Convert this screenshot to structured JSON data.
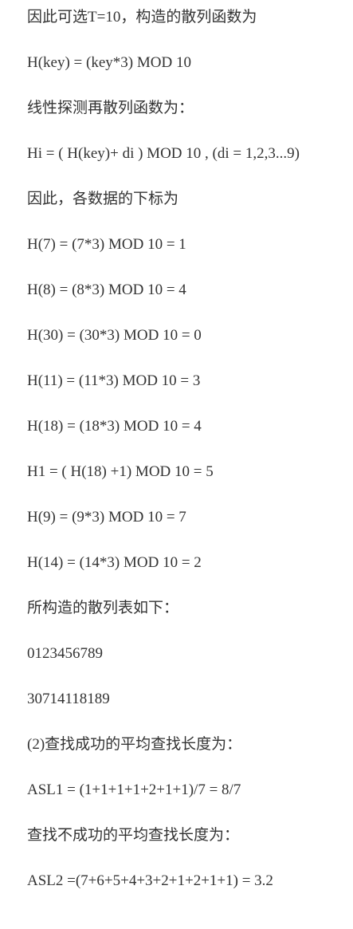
{
  "document": {
    "lines": [
      "因此可选T=10，构造的散列函数为",
      "H(key) = (key*3) MOD 10",
      "线性探测再散列函数为：",
      "Hi = ( H(key)+ di ) MOD 10 , (di = 1,2,3...9)",
      "因此，各数据的下标为",
      "H(7) = (7*3) MOD 10 = 1",
      "H(8) = (8*3) MOD 10 = 4",
      "H(30) = (30*3) MOD 10 = 0",
      "H(11) = (11*3) MOD 10 = 3",
      "H(18) = (18*3) MOD 10 = 4",
      "H1 = ( H(18) +1) MOD 10 = 5",
      "H(9) = (9*3) MOD 10 = 7",
      "H(14) = (14*3) MOD 10 = 2",
      "所构造的散列表如下：",
      "0123456789",
      "30714118189",
      "(2)查找成功的平均查找长度为：",
      "ASL1 = (1+1+1+1+2+1+1)/7 = 8/7",
      "查找不成功的平均查找长度为：",
      "ASL2 =(7+6+5+4+3+2+1+2+1+1) = 3.2"
    ]
  }
}
